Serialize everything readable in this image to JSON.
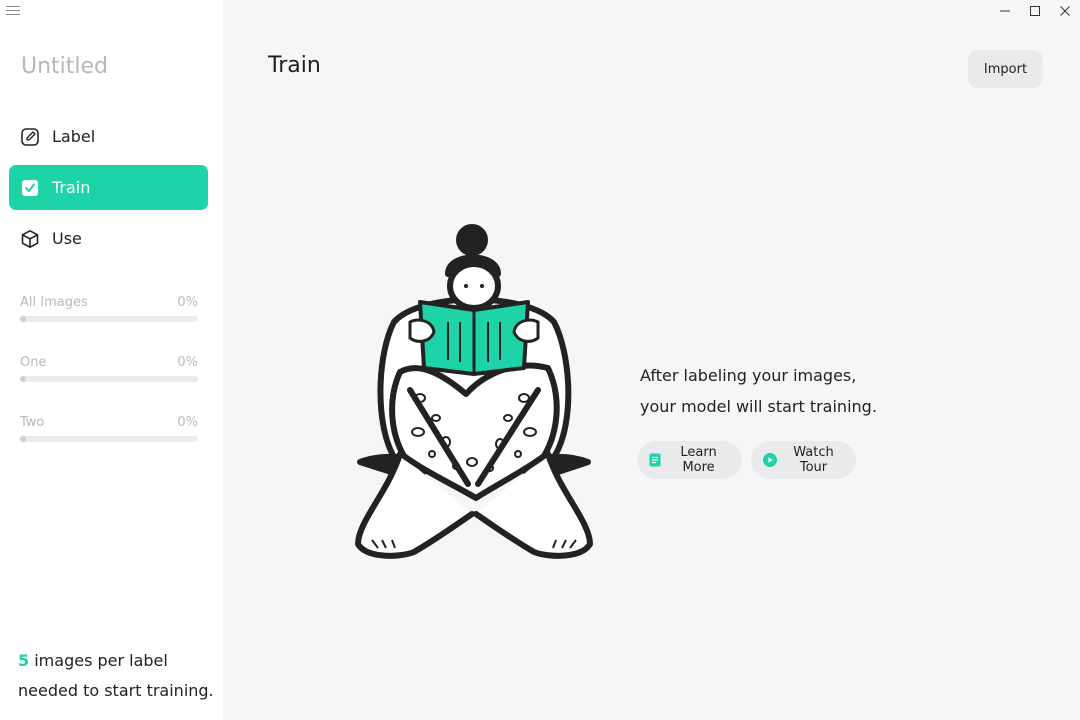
{
  "app": {
    "project_title": "Untitled"
  },
  "window_controls": [
    "minimize-icon",
    "maximize-icon",
    "close-icon"
  ],
  "sidebar": {
    "nav": [
      {
        "label": "Label",
        "icon": "pencil-icon",
        "active": false
      },
      {
        "label": "Train",
        "icon": "checkbox-icon",
        "active": true
      },
      {
        "label": "Use",
        "icon": "cube-icon",
        "active": false
      }
    ],
    "progress": [
      {
        "name": "All Images",
        "percent": "0%",
        "fraction": 0
      },
      {
        "name": "One",
        "percent": "0%",
        "fraction": 0
      },
      {
        "name": "Two",
        "percent": "0%",
        "fraction": 0
      }
    ],
    "footer": {
      "count": "5",
      "text_after_count": " images per label",
      "line2": "needed to start training."
    }
  },
  "main": {
    "title": "Train",
    "import_label": "Import",
    "message_line1": "After labeling your images,",
    "message_line2": "your model will start training.",
    "learn_more_label": "Learn More",
    "watch_tour_label": "Watch Tour"
  },
  "colors": {
    "accent": "#1dd3a7",
    "sidebar_bg": "#ffffff",
    "main_bg": "#f5f6f8",
    "button_bg": "#e9eaec"
  }
}
